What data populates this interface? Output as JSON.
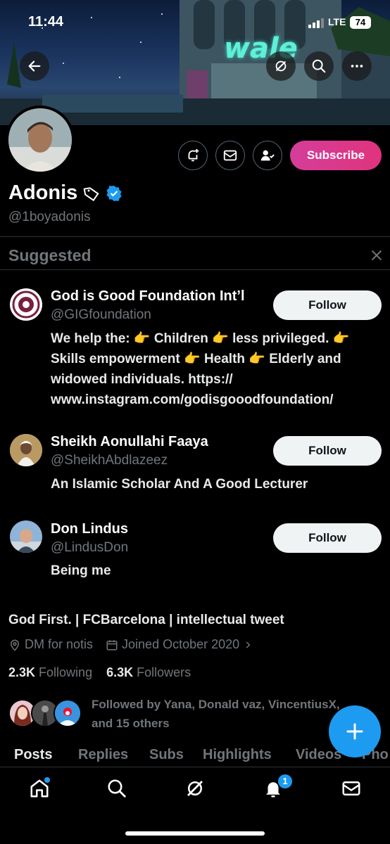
{
  "status_bar": {
    "time": "11:44",
    "network": "LTE",
    "battery": "74"
  },
  "banner": {
    "sign_text": "wale"
  },
  "header_actions": [
    "back-arrow-icon",
    "grok-icon",
    "search-icon",
    "more-icon"
  ],
  "profile": {
    "name": "Adonis",
    "handle": "@1boyadonis",
    "subscribe_label": "Subscribe",
    "bio": "God First. | FCBarcelona | intellectual tweet",
    "location": "DM for notis",
    "joined": "Joined October 2020",
    "following_count": "2.3K",
    "following_label": "Following",
    "followers_count": "6.3K",
    "followers_label": "Followers",
    "followed_by_text": "Followed by Yana, Donald vaz, VincentiusX, and 15 others"
  },
  "suggested": {
    "title": "Suggested",
    "follow_label": "Follow",
    "items": [
      {
        "name": "God is Good Foundation Int’l",
        "handle": "@GIGfoundation",
        "bio": "We help the: 👉 Children 👉 less privileged. 👉 Skills empowerment 👉 Health 👉 Elderly and widowed individuals. https:// www.instagram.com/godisgooodfoundation/"
      },
      {
        "name": "Sheikh Aonullahi Faaya",
        "handle": "@SheikhAbdlazeez",
        "bio": "An Islamic Scholar And A Good Lecturer"
      },
      {
        "name": "Don Lindus",
        "handle": "@LindusDon",
        "bio": "Being me"
      }
    ]
  },
  "tabs": [
    "Posts",
    "Replies",
    "Subs",
    "Highlights",
    "Videos",
    "Pho"
  ],
  "bottom_nav": {
    "notifications_badge": "1"
  },
  "colors": {
    "accent": "#1d9bf0",
    "subscribe": "#e0337d",
    "background": "#000000"
  }
}
